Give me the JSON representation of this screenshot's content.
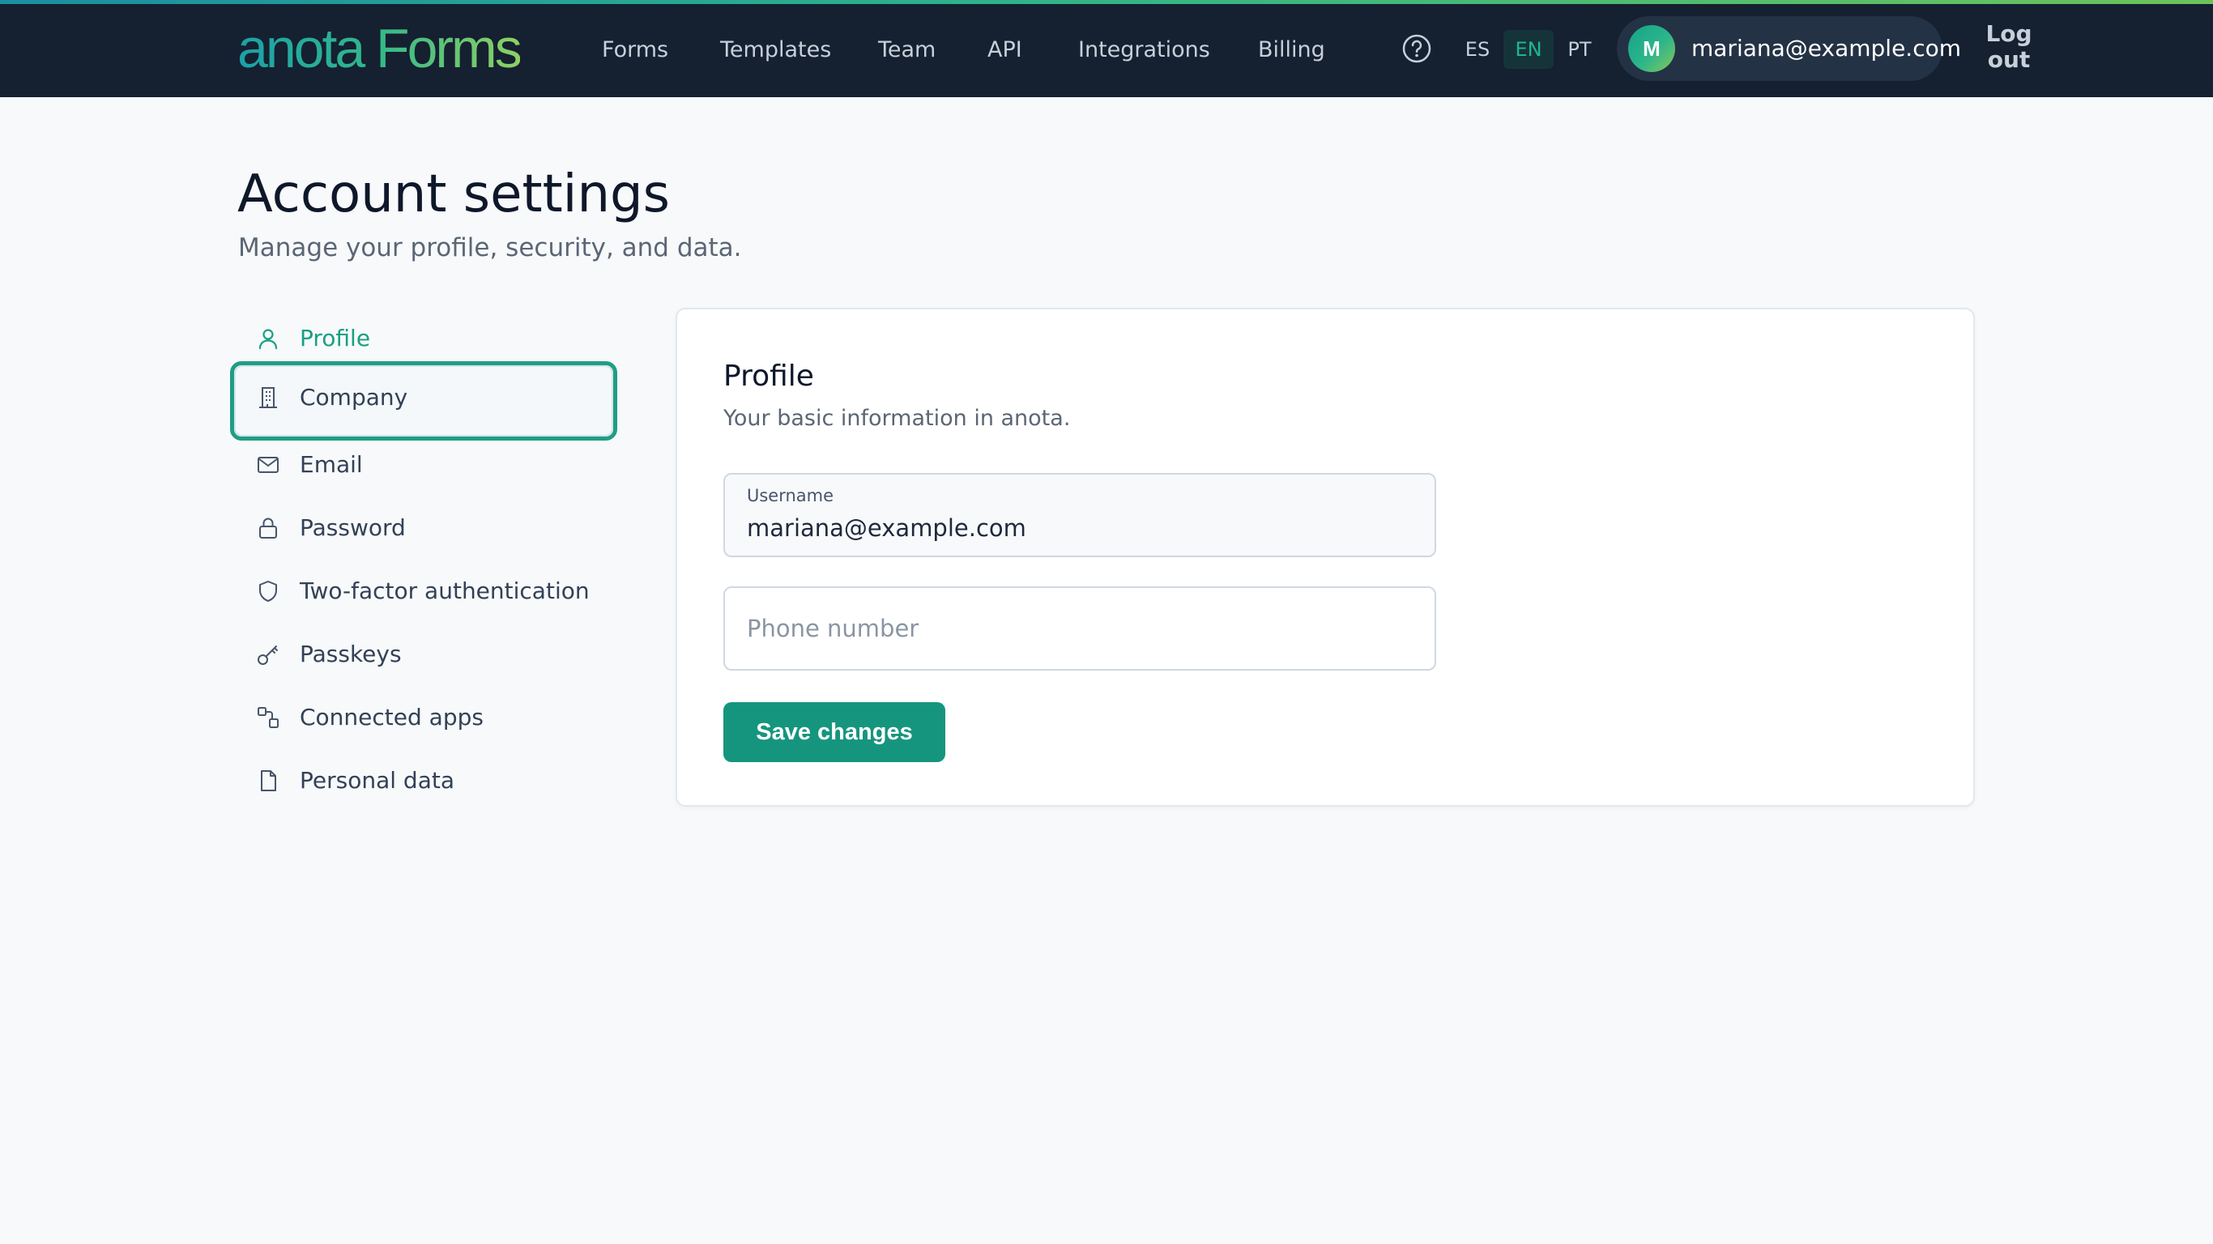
{
  "brand": {
    "name": "anota Forms"
  },
  "nav": {
    "links": [
      "Forms",
      "Templates",
      "Team",
      "API",
      "Integrations",
      "Billing"
    ],
    "help_icon": "question-circle-icon",
    "languages": [
      "ES",
      "EN",
      "PT"
    ],
    "active_language": "EN",
    "user": {
      "initial": "M",
      "email": "mariana@example.com"
    },
    "logout_label": "Log out"
  },
  "page": {
    "title": "Account settings",
    "subtitle": "Manage your profile, security, and data."
  },
  "sidebar": {
    "items": [
      {
        "label": "Profile",
        "icon": "user-icon",
        "state": "active"
      },
      {
        "label": "Company",
        "icon": "building-icon",
        "state": "focused"
      },
      {
        "label": "Email",
        "icon": "envelope-icon",
        "state": ""
      },
      {
        "label": "Password",
        "icon": "lock-icon",
        "state": ""
      },
      {
        "label": "Two-factor authentication",
        "icon": "shield-icon",
        "state": ""
      },
      {
        "label": "Passkeys",
        "icon": "key-icon",
        "state": ""
      },
      {
        "label": "Connected apps",
        "icon": "link-apps-icon",
        "state": ""
      },
      {
        "label": "Personal data",
        "icon": "document-icon",
        "state": ""
      }
    ]
  },
  "profile_card": {
    "title": "Profile",
    "subtitle": "Your basic information in anota.",
    "username": {
      "label": "Username",
      "value": "mariana@example.com"
    },
    "phone": {
      "placeholder": "Phone number",
      "value": ""
    },
    "save_label": "Save changes"
  },
  "colors": {
    "topbar": "#152030",
    "accent": "#16957e",
    "active_text": "#18a083",
    "focus_ring": "#1f9d85"
  }
}
